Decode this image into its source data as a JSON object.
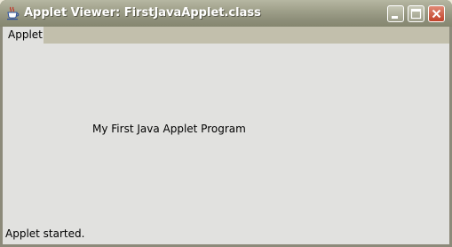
{
  "window": {
    "title": "Applet Viewer: FirstJavaApplet.class"
  },
  "menubar": {
    "items": [
      {
        "label": "Applet"
      }
    ]
  },
  "applet": {
    "text": "My First Java Applet Program"
  },
  "status": {
    "text": "Applet started."
  },
  "icons": {
    "app": "java-coffee-cup-icon",
    "minimize": "minimize-icon",
    "maximize": "maximize-icon",
    "close": "close-icon"
  },
  "colors": {
    "titlebar": "#9fa08a",
    "close_button": "#c2422a",
    "client_background": "#e1e1df",
    "menubar": "#c2bfac"
  }
}
